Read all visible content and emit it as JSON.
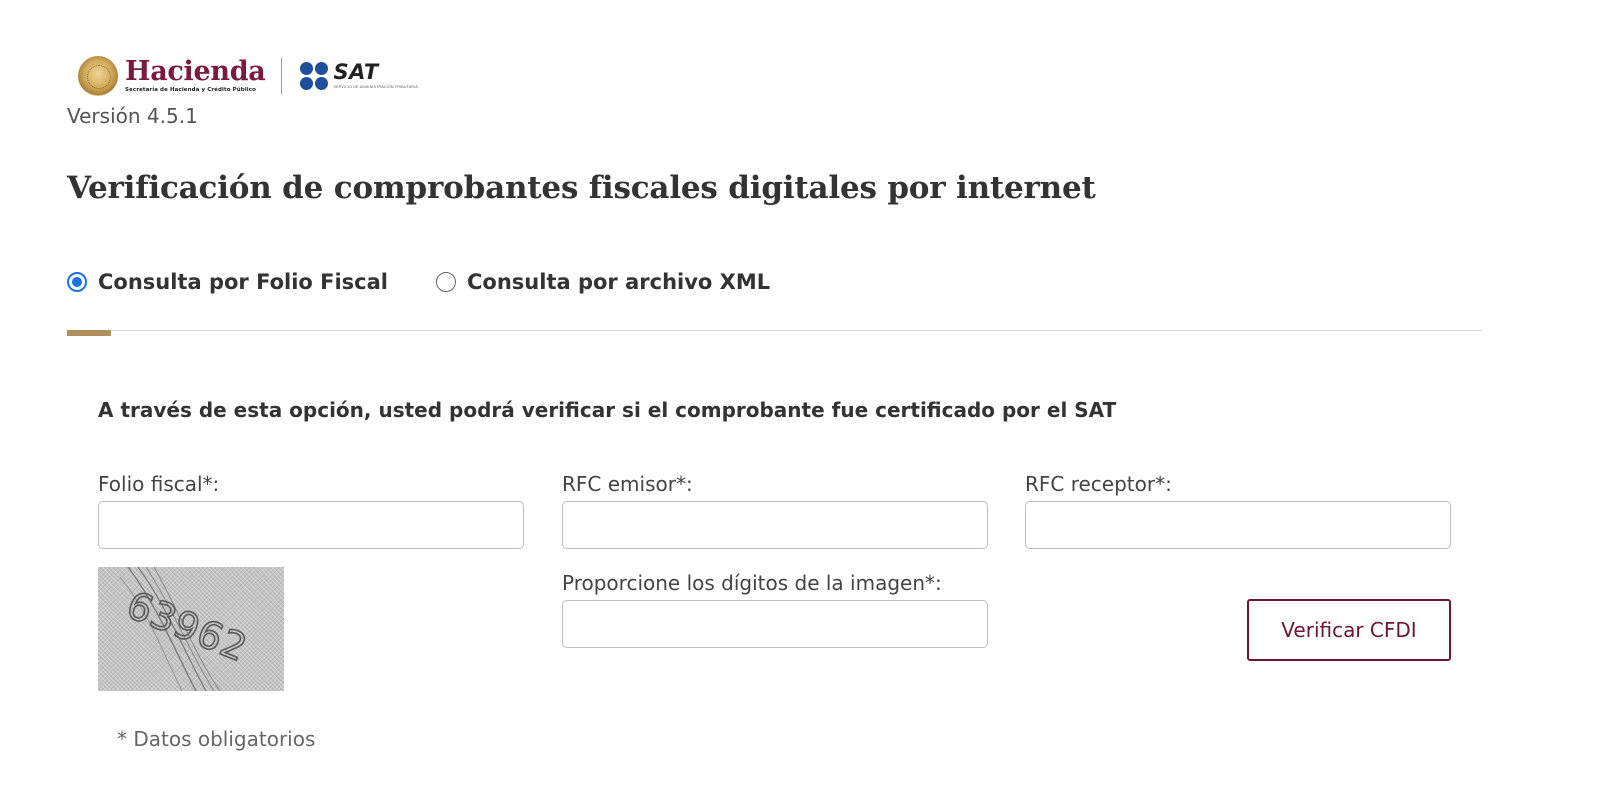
{
  "header": {
    "hacienda_name": "Hacienda",
    "hacienda_subtitle": "Secretaría de Hacienda y Crédito Público",
    "sat_name": "SAT",
    "sat_subtitle": "SERVICIO DE ADMINISTRACIÓN TRIBUTARIA",
    "version": "Versión 4.5.1",
    "brand_color": "#7b1a3c",
    "sat_color": "#1c4f9c"
  },
  "page": {
    "title": "Verificación de comprobantes fiscales digitales por internet"
  },
  "query_mode": {
    "selected": "folio",
    "options": [
      {
        "id": "folio",
        "label": "Consulta por Folio Fiscal",
        "checked": true
      },
      {
        "id": "xml",
        "label": "Consulta por archivo XML",
        "checked": false
      }
    ],
    "indicator_color": "#b38e5d"
  },
  "form": {
    "intro": "A través de esta opción, usted podrá verificar si el comprobante fue certificado por el SAT",
    "fields": {
      "folio": {
        "label": "Folio fiscal*:",
        "value": ""
      },
      "rfc_emisor": {
        "label": "RFC emisor*:",
        "value": ""
      },
      "rfc_receptor": {
        "label": "RFC receptor*:",
        "value": ""
      },
      "captcha": {
        "label": "Proporcione los dígitos de la imagen*:",
        "value": ""
      }
    },
    "captcha_image_text": "63962",
    "submit_label": "Verificar CFDI",
    "required_note": "* Datos obligatorios",
    "button_color": "#6b1634"
  }
}
